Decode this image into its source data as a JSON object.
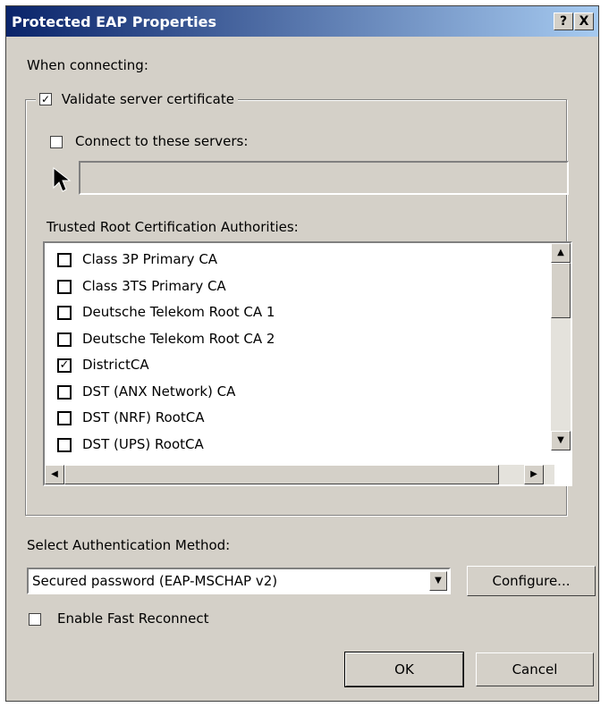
{
  "window": {
    "title": "Protected EAP Properties",
    "help_label": "?",
    "close_label": "X"
  },
  "labels": {
    "when_connecting": "When connecting:",
    "validate_cert": "Validate server certificate",
    "connect_servers": "Connect to these servers:",
    "trusted_root": "Trusted Root Certification Authorities:",
    "select_method": "Select Authentication Method:",
    "fast_reconnect": "Enable Fast Reconnect"
  },
  "checkboxes": {
    "validate_cert_checked": true,
    "connect_servers_checked": false,
    "fast_reconnect_checked": false
  },
  "servers_input": {
    "value": ""
  },
  "ca_list": [
    {
      "label": "Class 3P Primary CA",
      "checked": false
    },
    {
      "label": "Class 3TS Primary CA",
      "checked": false
    },
    {
      "label": "Deutsche Telekom Root CA 1",
      "checked": false
    },
    {
      "label": "Deutsche Telekom Root CA 2",
      "checked": false
    },
    {
      "label": "DistrictCA",
      "checked": true
    },
    {
      "label": "DST (ANX Network) CA",
      "checked": false
    },
    {
      "label": "DST (NRF) RootCA",
      "checked": false
    },
    {
      "label": "DST (UPS) RootCA",
      "checked": false
    }
  ],
  "auth_method": {
    "selected": "Secured password (EAP-MSCHAP v2)"
  },
  "buttons": {
    "configure": "Configure...",
    "ok": "OK",
    "cancel": "Cancel"
  },
  "icons": {
    "check_glyph": "✓",
    "up_arrow": "▲",
    "down_arrow": "▼",
    "left_arrow": "◀",
    "right_arrow": "▶",
    "cursor": "mouse-pointer-icon"
  }
}
